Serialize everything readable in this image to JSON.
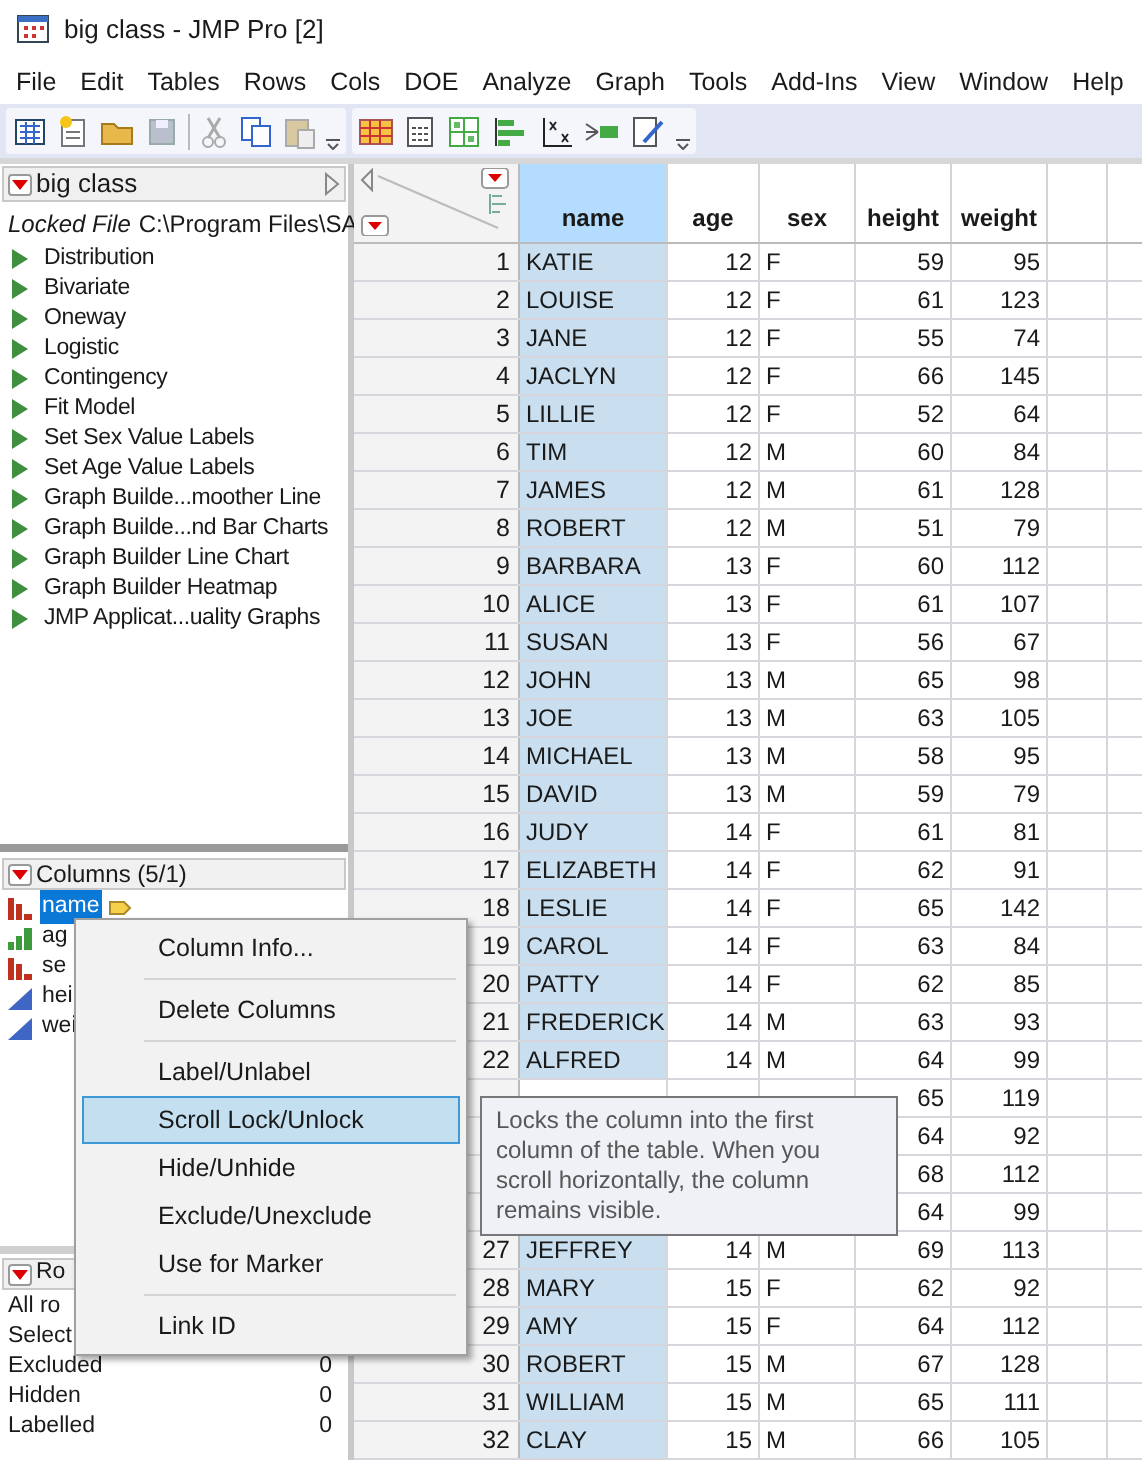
{
  "window": {
    "title": "big class - JMP Pro [2]"
  },
  "menu_bar": [
    "File",
    "Edit",
    "Tables",
    "Rows",
    "Cols",
    "DOE",
    "Analyze",
    "Graph",
    "Tools",
    "Add-Ins",
    "View",
    "Window",
    "Help"
  ],
  "table_panel": {
    "title": "big class",
    "locked_label": "Locked File",
    "path": "C:\\Program Files\\SA",
    "scripts": [
      "Distribution",
      "Bivariate",
      "Oneway",
      "Logistic",
      "Contingency",
      "Fit Model",
      "Set Sex Value Labels",
      "Set Age Value Labels",
      "Graph Builde...moother Line",
      "Graph Builde...nd Bar Charts",
      "Graph Builder Line Chart",
      "Graph Builder Heatmap",
      "JMP Applicat...uality Graphs"
    ]
  },
  "columns_panel": {
    "title": "Columns (5/1)",
    "columns": [
      {
        "name": "name",
        "kind": "nominal",
        "selected": true,
        "labelled": true
      },
      {
        "name": "ag",
        "kind": "ordinal",
        "selected": false
      },
      {
        "name": "se",
        "kind": "nominal",
        "selected": false
      },
      {
        "name": "hei",
        "kind": "continuous",
        "selected": false
      },
      {
        "name": "wei",
        "kind": "continuous",
        "selected": false
      }
    ]
  },
  "rows_panel": {
    "title": "Ro",
    "items": [
      {
        "label": "All ro"
      },
      {
        "label": "Select"
      },
      {
        "label": "Excluded",
        "value": "0"
      },
      {
        "label": "Hidden",
        "value": "0"
      },
      {
        "label": "Labelled",
        "value": "0"
      }
    ]
  },
  "data_table": {
    "columns": [
      {
        "name": "name",
        "selected": true
      },
      {
        "name": "age",
        "selected": false
      },
      {
        "name": "sex",
        "selected": false
      },
      {
        "name": "height",
        "selected": false
      },
      {
        "name": "weight",
        "selected": false
      }
    ],
    "rows": [
      {
        "number": "1",
        "cells": [
          "KATIE",
          "12",
          "F",
          "59",
          "95"
        ]
      },
      {
        "number": "2",
        "cells": [
          "LOUISE",
          "12",
          "F",
          "61",
          "123"
        ]
      },
      {
        "number": "3",
        "cells": [
          "JANE",
          "12",
          "F",
          "55",
          "74"
        ]
      },
      {
        "number": "4",
        "cells": [
          "JACLYN",
          "12",
          "F",
          "66",
          "145"
        ]
      },
      {
        "number": "5",
        "cells": [
          "LILLIE",
          "12",
          "F",
          "52",
          "64"
        ]
      },
      {
        "number": "6",
        "cells": [
          "TIM",
          "12",
          "M",
          "60",
          "84"
        ]
      },
      {
        "number": "7",
        "cells": [
          "JAMES",
          "12",
          "M",
          "61",
          "128"
        ]
      },
      {
        "number": "8",
        "cells": [
          "ROBERT",
          "12",
          "M",
          "51",
          "79"
        ]
      },
      {
        "number": "9",
        "cells": [
          "BARBARA",
          "13",
          "F",
          "60",
          "112"
        ]
      },
      {
        "number": "10",
        "cells": [
          "ALICE",
          "13",
          "F",
          "61",
          "107"
        ]
      },
      {
        "number": "11",
        "cells": [
          "SUSAN",
          "13",
          "F",
          "56",
          "67"
        ]
      },
      {
        "number": "12",
        "cells": [
          "JOHN",
          "13",
          "M",
          "65",
          "98"
        ]
      },
      {
        "number": "13",
        "cells": [
          "JOE",
          "13",
          "M",
          "63",
          "105"
        ]
      },
      {
        "number": "14",
        "cells": [
          "MICHAEL",
          "13",
          "M",
          "58",
          "95"
        ]
      },
      {
        "number": "15",
        "cells": [
          "DAVID",
          "13",
          "M",
          "59",
          "79"
        ]
      },
      {
        "number": "16",
        "cells": [
          "JUDY",
          "14",
          "F",
          "61",
          "81"
        ]
      },
      {
        "number": "17",
        "cells": [
          "ELIZABETH",
          "14",
          "F",
          "62",
          "91"
        ]
      },
      {
        "number": "18",
        "cells": [
          "LESLIE",
          "14",
          "F",
          "65",
          "142"
        ]
      },
      {
        "number": "19",
        "cells": [
          "CAROL",
          "14",
          "F",
          "63",
          "84"
        ]
      },
      {
        "number": "20",
        "cells": [
          "PATTY",
          "14",
          "F",
          "62",
          "85"
        ]
      },
      {
        "number": "21",
        "cells": [
          "FREDERICK",
          "14",
          "M",
          "63",
          "93"
        ]
      },
      {
        "number": "22",
        "cells": [
          "ALFRED",
          "14",
          "M",
          "64",
          "99"
        ]
      },
      {
        "cells": [
          null,
          null,
          null,
          "65",
          "119"
        ]
      },
      {
        "cells": [
          null,
          null,
          null,
          "64",
          "92"
        ]
      },
      {
        "cells": [
          null,
          null,
          null,
          "68",
          "112"
        ]
      },
      {
        "cells": [
          null,
          null,
          null,
          "64",
          "99"
        ]
      },
      {
        "number": "27",
        "cells": [
          "JEFFREY",
          "14",
          "M",
          "69",
          "113"
        ]
      },
      {
        "number": "28",
        "cells": [
          "MARY",
          "15",
          "F",
          "62",
          "92"
        ]
      },
      {
        "number": "29",
        "cells": [
          "AMY",
          "15",
          "F",
          "64",
          "112"
        ]
      },
      {
        "number": "30",
        "cells": [
          "ROBERT",
          "15",
          "M",
          "67",
          "128"
        ]
      },
      {
        "number": "31",
        "cells": [
          "WILLIAM",
          "15",
          "M",
          "65",
          "111"
        ]
      },
      {
        "number": "32",
        "cells": [
          "CLAY",
          "15",
          "M",
          "66",
          "105"
        ]
      }
    ]
  },
  "context_menu": {
    "items": [
      {
        "label": "Column Info...",
        "selected": false,
        "separator_after": true
      },
      {
        "label": "Delete Columns",
        "selected": false,
        "separator_after": true
      },
      {
        "label": "Label/Unlabel",
        "selected": false,
        "separator_after": false
      },
      {
        "label": "Scroll Lock/Unlock",
        "selected": true,
        "separator_after": false
      },
      {
        "label": "Hide/Unhide",
        "selected": false,
        "separator_after": false
      },
      {
        "label": "Exclude/Unexclude",
        "selected": false,
        "separator_after": false
      },
      {
        "label": "Use for Marker",
        "selected": false,
        "separator_after": true
      },
      {
        "label": "Link ID",
        "selected": false,
        "separator_after": false
      }
    ]
  },
  "tooltip": {
    "text": "Locks the column into the first column of the table. When you scroll horizontally, the column remains visible."
  }
}
